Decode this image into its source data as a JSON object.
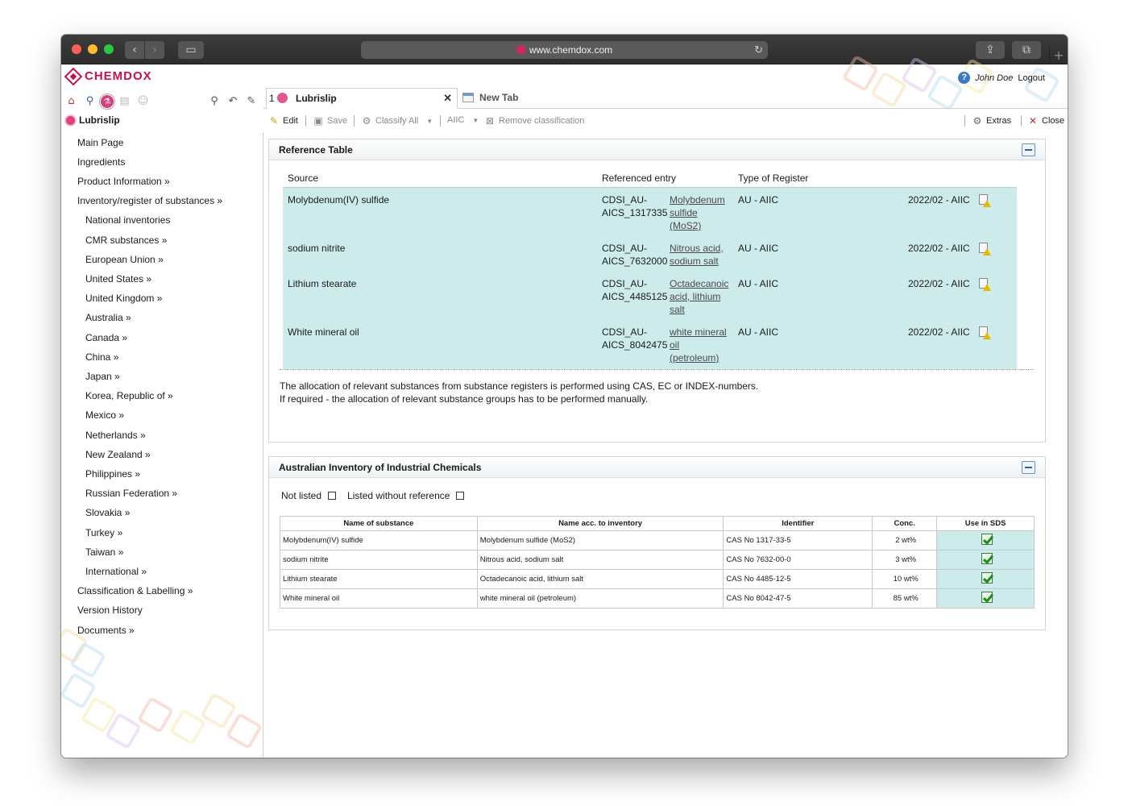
{
  "browser": {
    "url": "www.chemdox.com"
  },
  "app": {
    "logo": "CHEMDOX",
    "user": "John Doe",
    "logout": "Logout"
  },
  "tabs": [
    {
      "number": "1",
      "label": "Lubrislip",
      "close": "✕"
    },
    {
      "label": "New Tab"
    }
  ],
  "product": {
    "title": "Lubrislip"
  },
  "toolbar": {
    "edit": "Edit",
    "save": "Save",
    "classify_all": "Classify All",
    "aiic": "AIIC",
    "remove_classification": "Remove classification",
    "extras": "Extras",
    "close": "Close"
  },
  "nav": [
    {
      "label": "Main Page",
      "level": 1
    },
    {
      "label": "Ingredients",
      "level": 1
    },
    {
      "label": "Product Information »",
      "level": 1
    },
    {
      "label": "Inventory/register of substances »",
      "level": 1
    },
    {
      "label": "National inventories",
      "level": 2
    },
    {
      "label": "CMR substances »",
      "level": 2
    },
    {
      "label": "European Union »",
      "level": 2
    },
    {
      "label": "United States »",
      "level": 2
    },
    {
      "label": "United Kingdom »",
      "level": 2
    },
    {
      "label": "Australia »",
      "level": 2
    },
    {
      "label": "Canada »",
      "level": 2
    },
    {
      "label": "China »",
      "level": 2
    },
    {
      "label": "Japan »",
      "level": 2
    },
    {
      "label": "Korea, Republic of »",
      "level": 2
    },
    {
      "label": "Mexico »",
      "level": 2
    },
    {
      "label": "Netherlands »",
      "level": 2
    },
    {
      "label": "New Zealand »",
      "level": 2
    },
    {
      "label": "Philippines »",
      "level": 2
    },
    {
      "label": "Russian Federation »",
      "level": 2
    },
    {
      "label": "Slovakia »",
      "level": 2
    },
    {
      "label": "Turkey »",
      "level": 2
    },
    {
      "label": "Taiwan »",
      "level": 2
    },
    {
      "label": "International »",
      "level": 2
    },
    {
      "label": "Classification & Labelling »",
      "level": 1
    },
    {
      "label": "Version History",
      "level": 1
    },
    {
      "label": "Documents »",
      "level": 1
    }
  ],
  "reference_table": {
    "title": "Reference Table",
    "headers": {
      "source": "Source",
      "referenced_entry": "Referenced entry",
      "type_of_register": "Type of Register"
    },
    "rows": [
      {
        "source": "Molybdenum(IV) sulfide",
        "id_lines": [
          "CDSI_AU-",
          "AICS_1317335"
        ],
        "entry_lines": [
          "Molybdenum",
          "sulfide",
          "(MoS2)"
        ],
        "type": "AU - AIIC",
        "version": "2022/02 - AIIC"
      },
      {
        "source": "sodium nitrite",
        "id_lines": [
          "CDSI_AU-",
          "AICS_7632000"
        ],
        "entry_lines": [
          "Nitrous acid,",
          "sodium salt"
        ],
        "type": "AU - AIIC",
        "version": "2022/02 - AIIC"
      },
      {
        "source": "Lithium stearate",
        "id_lines": [
          "CDSI_AU-",
          "AICS_4485125"
        ],
        "entry_lines": [
          "Octadecanoic",
          "acid, lithium",
          "salt"
        ],
        "type": "AU - AIIC",
        "version": "2022/02 - AIIC"
      },
      {
        "source": "White mineral oil",
        "id_lines": [
          "CDSI_AU-",
          "AICS_8042475"
        ],
        "entry_lines": [
          "white mineral",
          "oil",
          "(petroleum)"
        ],
        "type": "AU - AIIC",
        "version": "2022/02 - AIIC"
      }
    ],
    "note_lines": [
      "The allocation of relevant substances from substance registers is performed using CAS, EC or INDEX-numbers.",
      "If required - the allocation of relevant substance groups has to be performed manually."
    ]
  },
  "aiic": {
    "title": "Australian Inventory of Industrial Chemicals",
    "filter_not_listed": "Not listed",
    "filter_without_reference": "Listed without reference",
    "columns": [
      "Name of substance",
      "Name acc. to inventory",
      "Identifier",
      "Conc.",
      "Use in SDS"
    ],
    "rows": [
      {
        "name": "Molybdenum(IV) sulfide",
        "inventory_name": "Molybdenum sulfide (MoS2)",
        "identifier": "CAS No 1317-33-5",
        "conc": "2 wt%",
        "use_in_sds": true
      },
      {
        "name": "sodium nitrite",
        "inventory_name": "Nitrous acid, sodium salt",
        "identifier": "CAS No 7632-00-0",
        "conc": "3 wt%",
        "use_in_sds": true
      },
      {
        "name": "Lithium stearate",
        "inventory_name": "Octadecanoic acid, lithium salt",
        "identifier": "CAS No 4485-12-5",
        "conc": "10 wt%",
        "use_in_sds": true
      },
      {
        "name": "White mineral oil",
        "inventory_name": "white mineral oil (petroleum)",
        "identifier": "CAS No 8042-47-5",
        "conc": "85 wt%",
        "use_in_sds": true
      }
    ]
  },
  "colors": {
    "brand": "#c4124a",
    "highlight_row": "#cdebeb",
    "chrome_dark": "#2d2d2d"
  }
}
